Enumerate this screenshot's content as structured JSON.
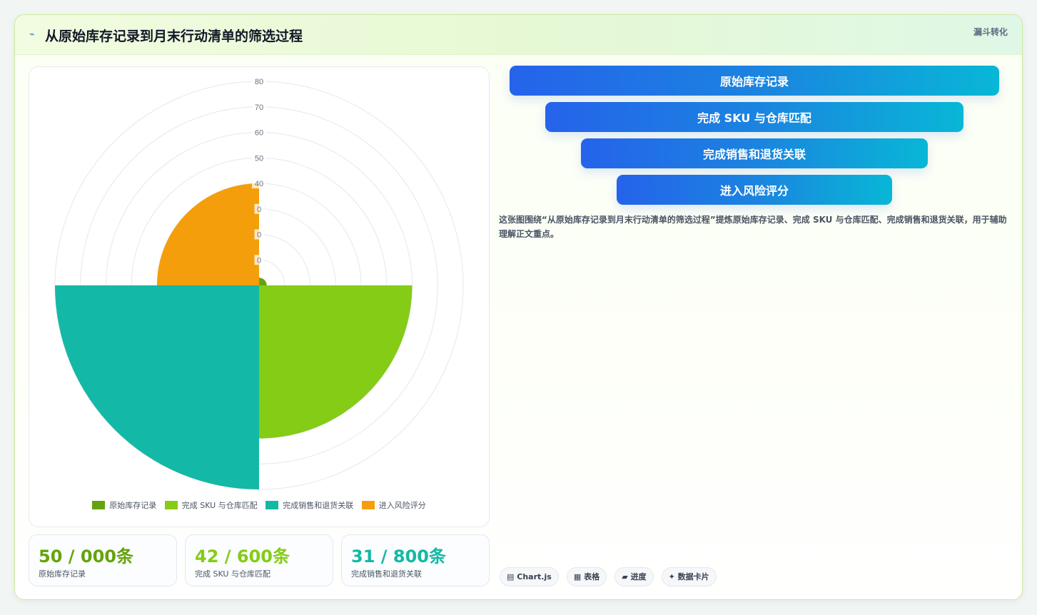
{
  "header": {
    "icon": "trend-icon",
    "title": "从原始库存记录到月末行动清单的筛选过程",
    "tag": "漏斗转化"
  },
  "chart_data": {
    "type": "polarArea",
    "categories": [
      "原始库存记录",
      "完成 SKU 与仓库匹配",
      "完成销售和退货关联",
      "进入风险评分"
    ],
    "values": [
      3,
      60,
      80,
      40
    ],
    "colors": [
      "#65a30d",
      "#84cc16",
      "#14b8a6",
      "#f59e0b"
    ],
    "r_ticks": [
      "80",
      "70",
      "60",
      "50",
      "40",
      "0",
      "0",
      "0"
    ],
    "r_range": [
      0,
      80
    ],
    "grid": true,
    "legend_position": "bottom"
  },
  "stats": [
    {
      "value": "50 / 000条",
      "label": "原始库存记录",
      "color": "#65a30d"
    },
    {
      "value": "42 / 600条",
      "label": "完成 SKU 与仓库匹配",
      "color": "#84cc16"
    },
    {
      "value": "31 / 800条",
      "label": "完成销售和退货关联",
      "color": "#14b8a6"
    }
  ],
  "funnel": [
    {
      "label": "原始库存记录"
    },
    {
      "label": "完成 SKU 与仓库匹配"
    },
    {
      "label": "完成销售和退货关联"
    },
    {
      "label": "进入风险评分"
    }
  ],
  "description": "这张图围绕“从原始库存记录到月末行动清单的筛选过程”提炼原始库存记录、完成 SKU 与仓库匹配、完成销售和退货关联，用于辅助理解正文重点。",
  "chips": [
    {
      "icon": "chart-icon",
      "glyph": "▤",
      "label": "Chart.js"
    },
    {
      "icon": "table-icon",
      "glyph": "▦",
      "label": "表格"
    },
    {
      "icon": "progress-icon",
      "glyph": "▰",
      "label": "进度"
    },
    {
      "icon": "sparkle-icon",
      "glyph": "✦",
      "label": "数据卡片"
    }
  ]
}
